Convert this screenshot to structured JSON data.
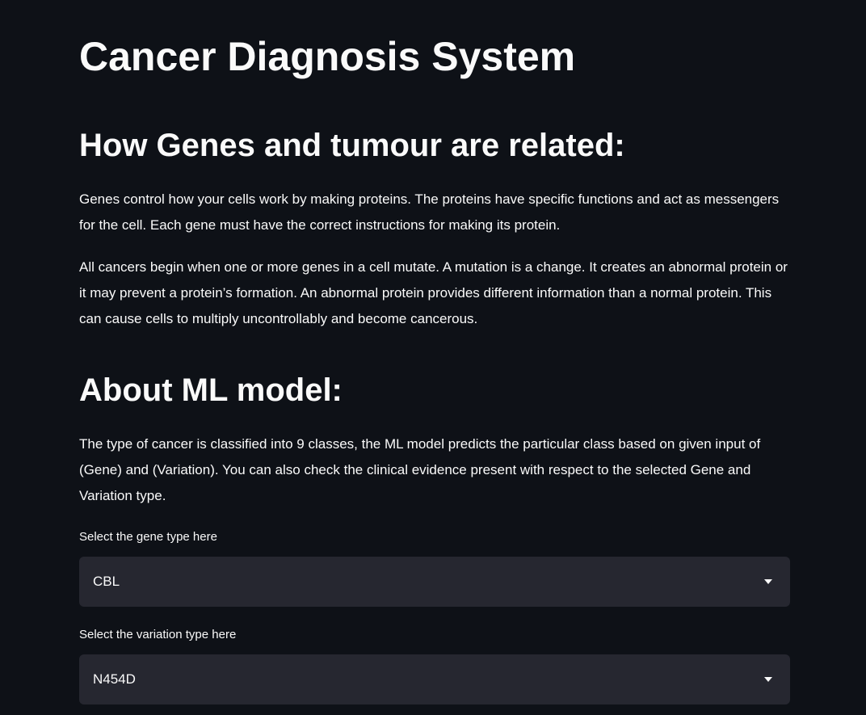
{
  "page": {
    "title": "Cancer Diagnosis System"
  },
  "genes_section": {
    "heading": "How Genes and tumour are related:",
    "paragraphs": [
      "Genes control how your cells work by making proteins. The proteins have specific functions and act as messengers for the cell. Each gene must have the correct instructions for making its protein.",
      "All cancers begin when one or more genes in a cell mutate. A mutation is a change. It creates an abnormal protein or it may prevent a protein’s formation. An abnormal protein provides different information than a normal protein. This can cause cells to multiply uncontrollably and become cancerous."
    ]
  },
  "model_section": {
    "heading": "About ML model:",
    "paragraph": "The type of cancer is classified into 9 classes, the ML model predicts the particular class based on given input of (Gene) and (Variation). You can also check the clinical evidence present with respect to the selected Gene and Variation type."
  },
  "gene_select": {
    "label": "Select the gene type here",
    "value": "CBL",
    "icon": "caret-down-icon"
  },
  "variation_select": {
    "label": "Select the variation type here",
    "value": "N454D",
    "icon": "caret-down-icon"
  },
  "colors": {
    "background": "#0e1117",
    "text": "#fafafa",
    "select_background": "#262730"
  }
}
